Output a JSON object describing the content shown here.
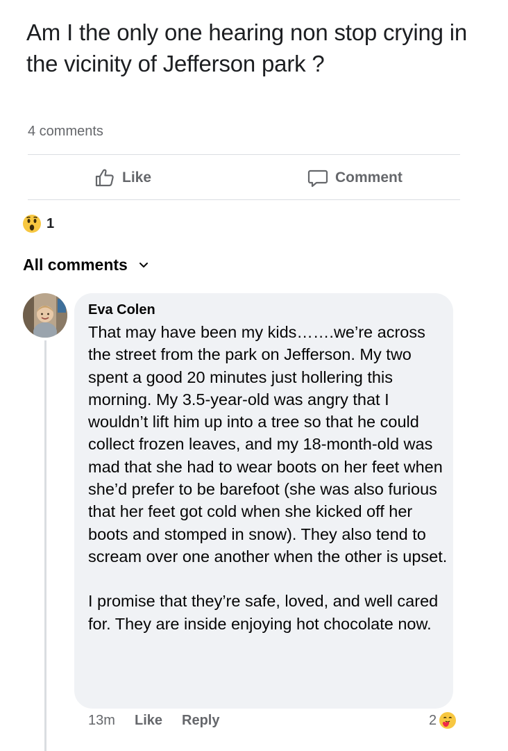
{
  "post": {
    "text": "Am I the only one hearing non stop crying in the vicinity of Jefferson park ?",
    "comment_count": "4 comments"
  },
  "actions": {
    "like_label": "Like",
    "comment_label": "Comment"
  },
  "reactions": {
    "icon": "wow-emoji-icon",
    "count": "1"
  },
  "comments_filter": {
    "label": "All comments"
  },
  "comment": {
    "author": "Eva Colen",
    "paragraph1": "That may have been my kids…….we’re across the street from the park on Jefferson. My two spent a good 20 minutes just hollering this morning. My 3.5-year-old was angry that I wouldn’t lift him up into a tree so that he could collect frozen leaves, and my 18-month-old was mad that she had to wear boots on her feet when she’d prefer to be barefoot (she was also furious that her feet got cold when she kicked off her boots and stomped in snow). They also tend to scream over one another when the other is upset.",
    "paragraph2": "I promise that they’re safe, loved, and well cared for. They are inside enjoying hot chocolate now.",
    "time": "13m",
    "like_label": "Like",
    "reply_label": "Reply",
    "reaction_count": "2",
    "reaction_icon": "care-emoji-icon"
  },
  "colors": {
    "secondary_text": "#65676b",
    "bubble_bg": "#f0f2f5",
    "divider": "#dadde1"
  }
}
